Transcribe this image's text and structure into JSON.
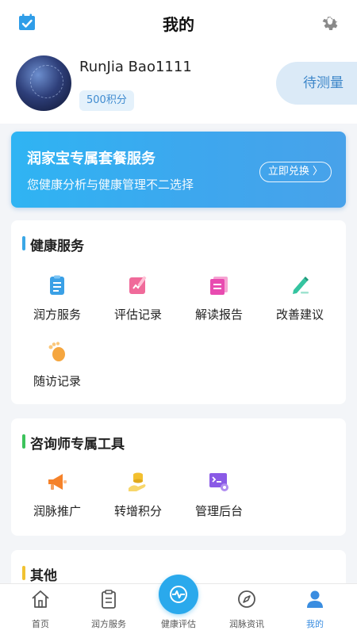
{
  "header": {
    "title": "我的"
  },
  "profile": {
    "name": "RunJia Bao1111",
    "points": "500积分",
    "pending_label": "待测量"
  },
  "banner": {
    "title": "润家宝专属套餐服务",
    "subtitle": "您健康分析与健康管理不二选择",
    "button": "立即兑换 〉"
  },
  "health_services": {
    "title": "健康服务",
    "accent": "#3aa7e6",
    "items": [
      {
        "label": "润方服务",
        "icon": "clipboard-list-icon"
      },
      {
        "label": "评估记录",
        "icon": "edit-note-icon"
      },
      {
        "label": "解读报告",
        "icon": "report-icon"
      },
      {
        "label": "改善建议",
        "icon": "pencil-icon"
      },
      {
        "label": "随访记录",
        "icon": "footprint-icon"
      }
    ]
  },
  "consultant_tools": {
    "title": "咨询师专属工具",
    "accent": "#3cc35b",
    "items": [
      {
        "label": "润脉推广",
        "icon": "megaphone-icon"
      },
      {
        "label": "转增积分",
        "icon": "coins-hand-icon"
      },
      {
        "label": "管理后台",
        "icon": "admin-terminal-icon"
      }
    ]
  },
  "others": {
    "title": "其他",
    "accent": "#f1c232"
  },
  "bottom_nav": {
    "items": [
      {
        "label": "首页",
        "icon": "home-icon"
      },
      {
        "label": "润方服务",
        "icon": "clipboard-icon"
      },
      {
        "label": "健康评估",
        "icon": "heartbeat-icon"
      },
      {
        "label": "润脉资讯",
        "icon": "compass-icon"
      },
      {
        "label": "我的",
        "icon": "user-icon"
      }
    ],
    "active": "我的"
  }
}
